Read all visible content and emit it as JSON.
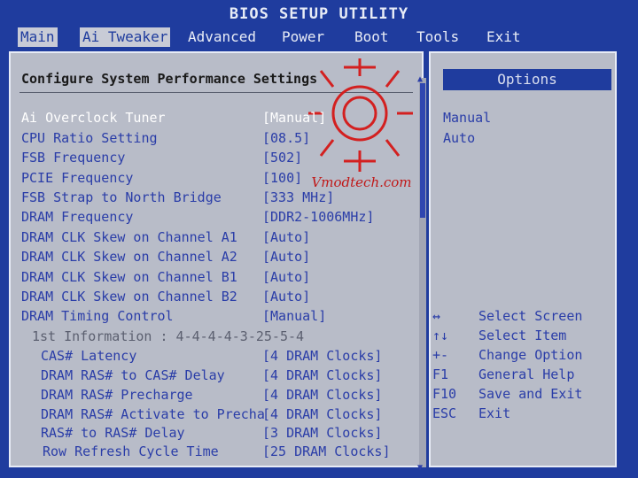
{
  "window": {
    "title": "BIOS SETUP UTILITY"
  },
  "tabs": [
    {
      "label": "Main"
    },
    {
      "label": "Ai Tweaker"
    },
    {
      "label": "Advanced"
    },
    {
      "label": "Power"
    },
    {
      "label": "Boot"
    },
    {
      "label": "Tools"
    },
    {
      "label": "Exit"
    }
  ],
  "main": {
    "section_title": "Configure System Performance Settings",
    "watermark": "Vmodtech.com",
    "rows": [
      {
        "label": "Ai Overclock Tuner",
        "value": "[Manual]"
      },
      {
        "label": "CPU Ratio Setting",
        "value": "[08.5]"
      },
      {
        "label": "FSB Frequency",
        "value": "[502]"
      },
      {
        "label": "PCIE Frequency",
        "value": "[100]"
      },
      {
        "label": "FSB Strap to North Bridge",
        "value": "[333 MHz]"
      },
      {
        "label": "DRAM Frequency",
        "value": "[DDR2-1006MHz]"
      },
      {
        "label": "DRAM CLK Skew on Channel A1",
        "value": "[Auto]"
      },
      {
        "label": "DRAM CLK Skew on Channel A2",
        "value": "[Auto]"
      },
      {
        "label": "DRAM CLK Skew on Channel B1",
        "value": "[Auto]"
      },
      {
        "label": "DRAM CLK Skew on Channel B2",
        "value": "[Auto]"
      },
      {
        "label": "DRAM Timing Control",
        "value": "[Manual]"
      },
      {
        "label": "1st Information : 4-4-4-4-3-25-5-4",
        "value": ""
      },
      {
        "label": "CAS# Latency",
        "value": "[4 DRAM Clocks]"
      },
      {
        "label": "DRAM RAS# to CAS# Delay",
        "value": "[4 DRAM Clocks]"
      },
      {
        "label": "DRAM RAS# Precharge",
        "value": "[4 DRAM Clocks]"
      },
      {
        "label": "DRAM RAS# Activate to Precha",
        "value": "[4 DRAM Clocks]"
      },
      {
        "label": "RAS# to RAS# Delay",
        "value": "[3 DRAM Clocks]"
      },
      {
        "label": "Row Refresh Cycle Time",
        "value": "[25 DRAM Clocks]"
      }
    ]
  },
  "options": {
    "header": "Options",
    "items": [
      "Manual",
      "Auto"
    ]
  },
  "help": [
    {
      "key": "↔",
      "desc": "Select Screen"
    },
    {
      "key": "↑↓",
      "desc": "Select Item"
    },
    {
      "key": "+-",
      "desc": "Change Option"
    },
    {
      "key": "F1",
      "desc": "General Help"
    },
    {
      "key": "F10",
      "desc": "Save and Exit"
    },
    {
      "key": "ESC",
      "desc": "Exit"
    }
  ],
  "colors": {
    "background_blue": "#1f3c9e",
    "panel_gray": "#b8bcc8",
    "text_blue": "#2a3da8",
    "selected_text": "#ffffff"
  }
}
